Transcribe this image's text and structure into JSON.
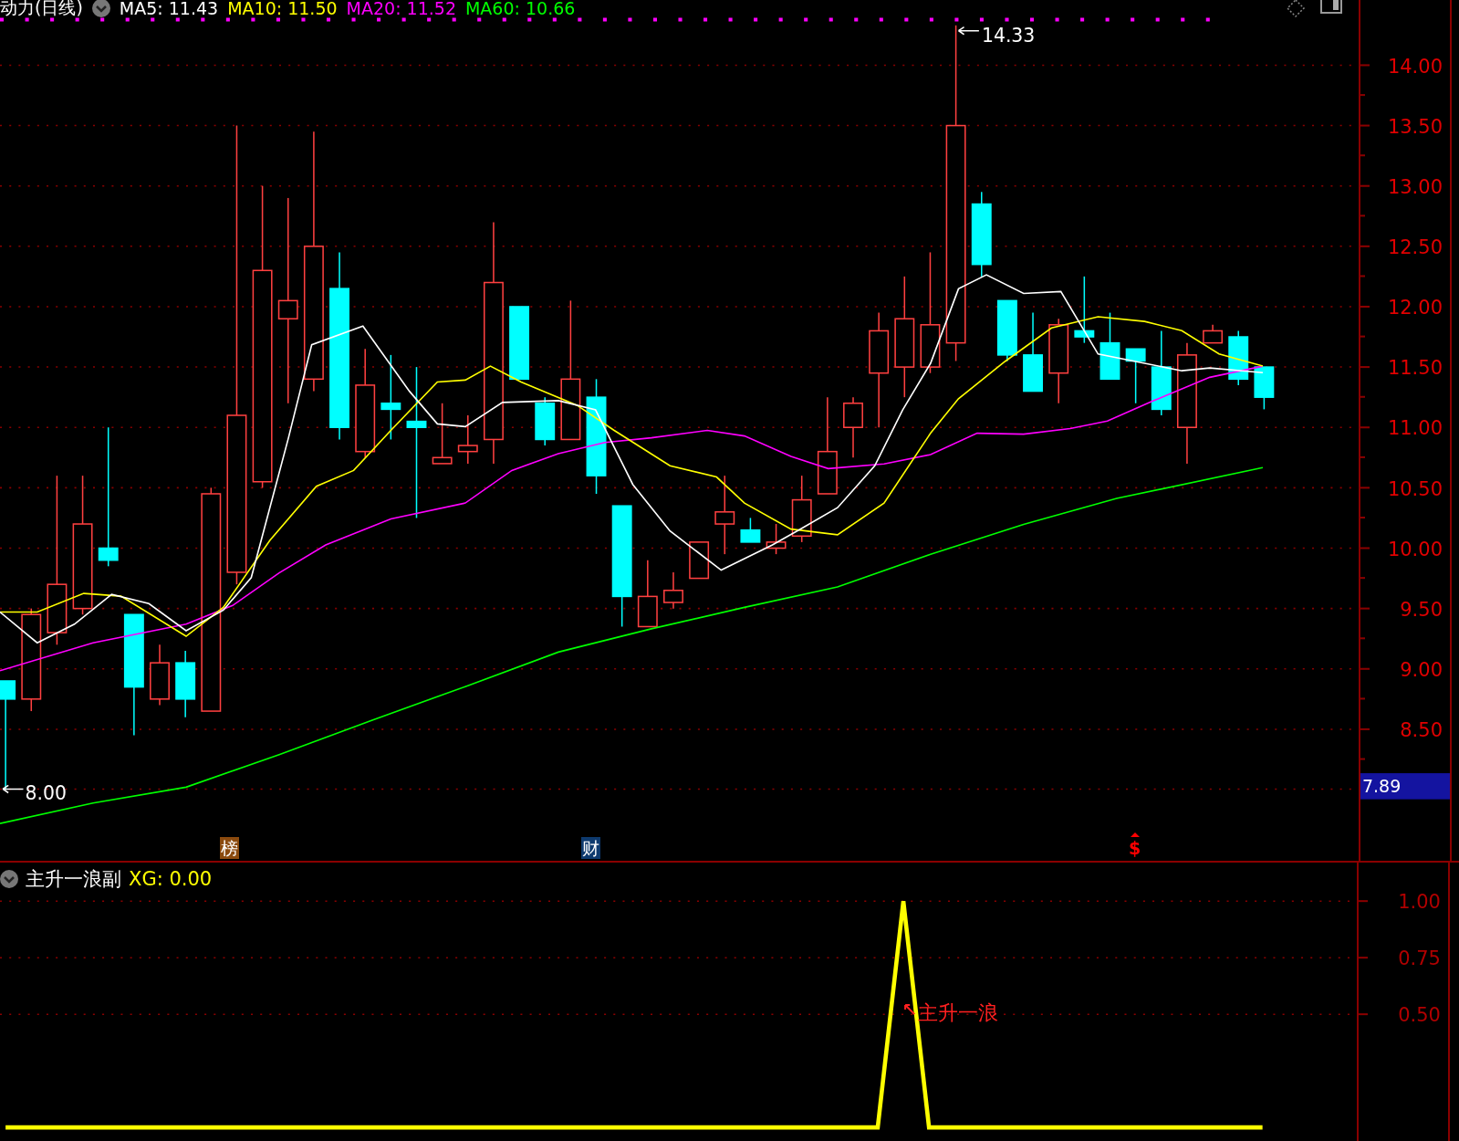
{
  "header": {
    "title": "动力(日线)",
    "indicators": [
      {
        "label": "MA5: 11.43",
        "color": "#ffffff"
      },
      {
        "label": "MA10: 11.50",
        "color": "#ffff00"
      },
      {
        "label": "MA20: 11.52",
        "color": "#ff00ff"
      },
      {
        "label": "MA60: 10.66",
        "color": "#00ff00"
      }
    ]
  },
  "main_chart": {
    "axis_labels": [
      "14.00",
      "13.50",
      "13.00",
      "12.50",
      "12.00",
      "11.50",
      "11.00",
      "10.50",
      "10.00",
      "9.50",
      "9.00",
      "8.50"
    ],
    "last_price": "7.89",
    "high_label": "14.33",
    "low_label": "8.00",
    "markers": [
      {
        "kind": "tag",
        "text": "榜",
        "color": "#8b4a0e"
      },
      {
        "kind": "tag",
        "text": "财",
        "color": "#0e3a6e"
      },
      {
        "kind": "symbol",
        "text": "$",
        "color": "#ff0000"
      }
    ]
  },
  "lower_panel": {
    "title": "主升一浪副",
    "readout": "XG: 0.00",
    "chart_data": {
      "type": "line",
      "ylim": [
        -0.06,
        1.17
      ],
      "grid": true,
      "yticks": [
        {
          "value": 0.5,
          "label": "0.50"
        },
        {
          "value": 0.75,
          "label": "0.75"
        },
        {
          "value": 1,
          "label": "1.00"
        }
      ],
      "series": [
        {
          "color": "#ffff00",
          "values": [
            0,
            0,
            0,
            0,
            0,
            0,
            0,
            0,
            0,
            0,
            0,
            0,
            0,
            0,
            0,
            0,
            0,
            0,
            0,
            0,
            0,
            0,
            0,
            0,
            0,
            0,
            0,
            0,
            0,
            0,
            0,
            0,
            0,
            0,
            0,
            1,
            0,
            0,
            0,
            0,
            0,
            0,
            0,
            0,
            0,
            0,
            0,
            0,
            0,
            0
          ]
        }
      ],
      "annotations": [
        "主升一浪"
      ]
    }
  }
}
